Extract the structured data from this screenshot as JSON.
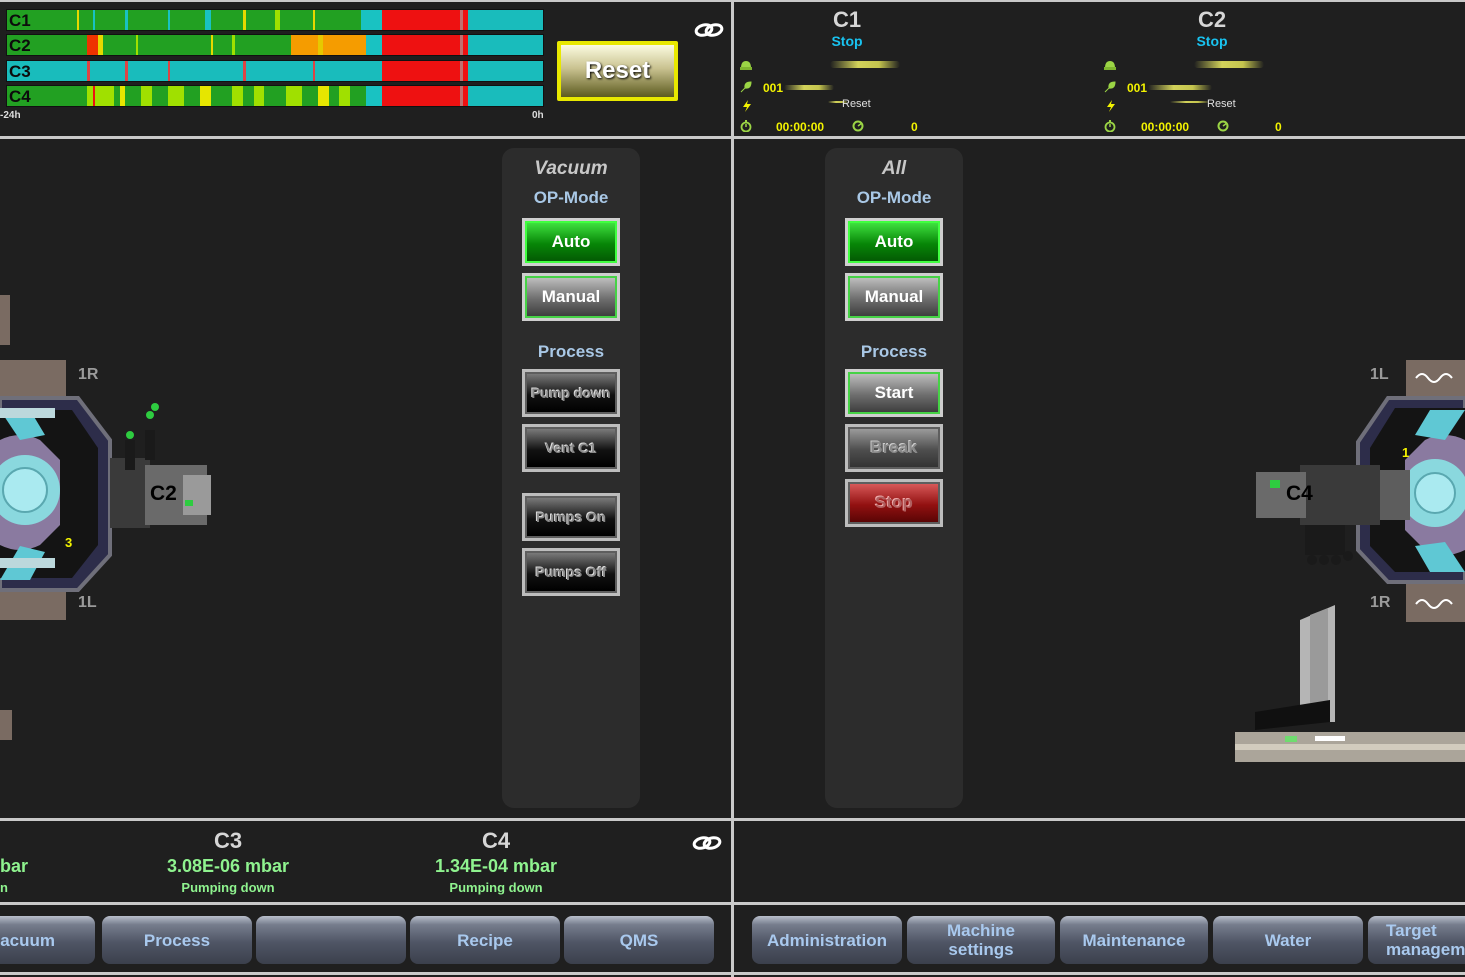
{
  "timeline": {
    "rows": [
      {
        "label": "C1",
        "segments": [
          {
            "start": 0,
            "end": 0.66,
            "color": "#22a022"
          },
          {
            "start": 0.13,
            "end": 0.135,
            "color": "#e6d800"
          },
          {
            "start": 0.16,
            "end": 0.165,
            "color": "#19c2c2"
          },
          {
            "start": 0.22,
            "end": 0.225,
            "color": "#19c2c2"
          },
          {
            "start": 0.3,
            "end": 0.305,
            "color": "#19c2c2"
          },
          {
            "start": 0.37,
            "end": 0.38,
            "color": "#19c2c2"
          },
          {
            "start": 0.44,
            "end": 0.445,
            "color": "#e6d800"
          },
          {
            "start": 0.5,
            "end": 0.51,
            "color": "#a0e000"
          },
          {
            "start": 0.57,
            "end": 0.575,
            "color": "#e6d800"
          },
          {
            "start": 0.66,
            "end": 0.7,
            "color": "#19c2c2"
          },
          {
            "start": 0.7,
            "end": 0.86,
            "color": "#ee1111"
          },
          {
            "start": 0.845,
            "end": 0.85,
            "color": "#c07070"
          },
          {
            "start": 0.86,
            "end": 1,
            "color": "#19bcbc"
          }
        ]
      },
      {
        "label": "C2",
        "segments": [
          {
            "start": 0,
            "end": 0.53,
            "color": "#22a022"
          },
          {
            "start": 0.15,
            "end": 0.17,
            "color": "#ee3300"
          },
          {
            "start": 0.17,
            "end": 0.18,
            "color": "#e6d800"
          },
          {
            "start": 0.24,
            "end": 0.245,
            "color": "#a0e000"
          },
          {
            "start": 0.38,
            "end": 0.385,
            "color": "#e6d800"
          },
          {
            "start": 0.42,
            "end": 0.425,
            "color": "#a0e000"
          },
          {
            "start": 0.53,
            "end": 0.67,
            "color": "#f59c00"
          },
          {
            "start": 0.58,
            "end": 0.59,
            "color": "#e6c800"
          },
          {
            "start": 0.67,
            "end": 0.7,
            "color": "#19c2c2"
          },
          {
            "start": 0.7,
            "end": 0.86,
            "color": "#ee1111"
          },
          {
            "start": 0.845,
            "end": 0.85,
            "color": "#c07070"
          },
          {
            "start": 0.86,
            "end": 1,
            "color": "#19bcbc"
          }
        ]
      },
      {
        "label": "C3",
        "segments": [
          {
            "start": 0,
            "end": 0.7,
            "color": "#19bcbc"
          },
          {
            "start": 0.15,
            "end": 0.155,
            "color": "#d44"
          },
          {
            "start": 0.22,
            "end": 0.225,
            "color": "#d44"
          },
          {
            "start": 0.3,
            "end": 0.305,
            "color": "#d44"
          },
          {
            "start": 0.44,
            "end": 0.445,
            "color": "#d44"
          },
          {
            "start": 0.57,
            "end": 0.575,
            "color": "#d44"
          },
          {
            "start": 0.7,
            "end": 0.86,
            "color": "#ee1111"
          },
          {
            "start": 0.845,
            "end": 0.85,
            "color": "#c07070"
          },
          {
            "start": 0.86,
            "end": 1,
            "color": "#19bcbc"
          }
        ]
      },
      {
        "label": "C4",
        "segments": [
          {
            "start": 0,
            "end": 0.67,
            "color": "#22a022"
          },
          {
            "start": 0.15,
            "end": 0.2,
            "color": "#a0e000"
          },
          {
            "start": 0.16,
            "end": 0.165,
            "color": "#ee1111"
          },
          {
            "start": 0.21,
            "end": 0.22,
            "color": "#e6e600"
          },
          {
            "start": 0.25,
            "end": 0.27,
            "color": "#a0e000"
          },
          {
            "start": 0.3,
            "end": 0.33,
            "color": "#a0e000"
          },
          {
            "start": 0.36,
            "end": 0.38,
            "color": "#e6e600"
          },
          {
            "start": 0.42,
            "end": 0.44,
            "color": "#a0e000"
          },
          {
            "start": 0.46,
            "end": 0.48,
            "color": "#a0e000"
          },
          {
            "start": 0.52,
            "end": 0.55,
            "color": "#a0e000"
          },
          {
            "start": 0.58,
            "end": 0.6,
            "color": "#e6e600"
          },
          {
            "start": 0.62,
            "end": 0.64,
            "color": "#a0e000"
          },
          {
            "start": 0.67,
            "end": 0.7,
            "color": "#19c2c2"
          },
          {
            "start": 0.7,
            "end": 0.86,
            "color": "#ee1111"
          },
          {
            "start": 0.845,
            "end": 0.85,
            "color": "#c07070"
          },
          {
            "start": 0.86,
            "end": 1,
            "color": "#19bcbc"
          }
        ]
      }
    ],
    "axis_start": "-24h",
    "axis_end": "0h"
  },
  "reset_button": "Reset",
  "chambers_top": [
    {
      "name": "C1",
      "state": "Stop",
      "recipe_no": "001",
      "action": "Reset",
      "time": "00:00:00",
      "count": "0"
    },
    {
      "name": "C2",
      "state": "Stop",
      "recipe_no": "001",
      "action": "Reset",
      "time": "00:00:00",
      "count": "0"
    }
  ],
  "vacuum_panel": {
    "title": "Vacuum",
    "opmode_label": "OP-Mode",
    "auto": "Auto",
    "manual": "Manual",
    "process_label": "Process",
    "pump_down": "Pump down",
    "vent": "Vent C1",
    "pumps_on": "Pumps On",
    "pumps_off": "Pumps Off"
  },
  "all_panel": {
    "title": "All",
    "opmode_label": "OP-Mode",
    "auto": "Auto",
    "manual": "Manual",
    "process_label": "Process",
    "start": "Start",
    "break": "Break",
    "stop": "Stop"
  },
  "left_machine": {
    "r_label": "1R",
    "l_label": "1L",
    "chamber": "C2",
    "number": "3"
  },
  "right_machine": {
    "l_label": "1L",
    "r_label": "1R",
    "chamber": "C4",
    "number": "1"
  },
  "pressures": [
    {
      "name": "",
      "value": "bar",
      "status": "n"
    },
    {
      "name": "C3",
      "value": "3.08E-06 mbar",
      "status": "Pumping down"
    },
    {
      "name": "C4",
      "value": "1.34E-04 mbar",
      "status": "Pumping down"
    }
  ],
  "nav": {
    "left": [
      "acuum",
      "Process",
      "",
      "Recipe",
      "QMS"
    ],
    "right": [
      "Administration",
      "Machine settings",
      "Maintenance",
      "Water",
      "Target managem"
    ]
  },
  "colors": {
    "accent_green": "#8ff38f",
    "state_blue": "#19c3f0",
    "reset_yellow": "#e8e800",
    "status_yellow": "#f3f300"
  }
}
